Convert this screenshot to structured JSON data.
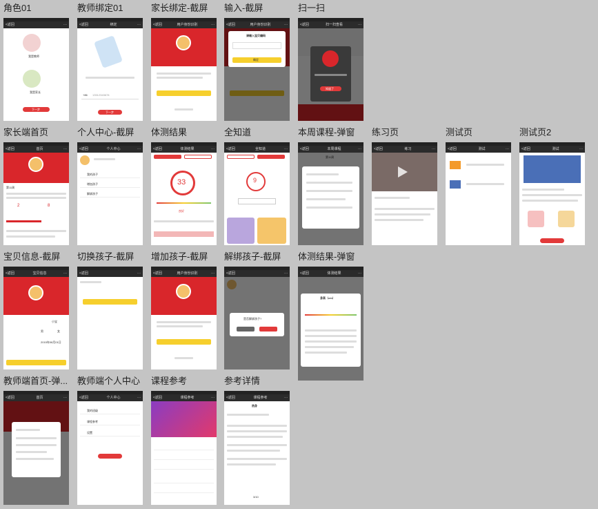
{
  "screens": [
    {
      "title": "角色01"
    },
    {
      "title": "教师绑定01"
    },
    {
      "title": "家长绑定-截屏"
    },
    {
      "title": "输入-截屏"
    },
    {
      "title": "扫一扫"
    },
    {
      "title": "家长端首页"
    },
    {
      "title": "个人中心-截屏"
    },
    {
      "title": "体测结果"
    },
    {
      "title": "全知道"
    },
    {
      "title": "本周课程-弹窗"
    },
    {
      "title": "练习页"
    },
    {
      "title": "测试页"
    },
    {
      "title": "测试页2"
    },
    {
      "title": "宝贝信息-截屏"
    },
    {
      "title": "切换孩子-截屏"
    },
    {
      "title": "增加孩子-截屏"
    },
    {
      "title": "解绑孩子-截屏"
    },
    {
      "title": "体测结果-弹窗"
    },
    {
      "title": "教师端首页-弹..."
    },
    {
      "title": "教师端个人中心"
    },
    {
      "title": "课程参考"
    },
    {
      "title": "参考详情"
    }
  ],
  "nav": {
    "back": "<返回",
    "close": "关闭",
    "more": "···",
    "t_bind": "绑定",
    "t_identity": "用户身份识别",
    "t_scan": "扫一扫查看",
    "t_home": "首页",
    "t_center": "个人中心",
    "t_test": "体测结果",
    "t_know": "全知道",
    "t_course": "本周课程",
    "t_practice": "练习",
    "t_exam": "测试",
    "t_ref": "课程参考",
    "t_refd": "课程参考",
    "t_baby": "宝贝信息"
  },
  "texts": {
    "next": "下一步",
    "bind_teacher": "我是教师",
    "bind_parent": "我是家长",
    "phone_prefix": "+86",
    "phone_num": "13512345678",
    "input_baby": "请输入宝贝编码",
    "confirm": "确定",
    "scan_known": "知道了",
    "scan_tip": "请用微信扫码",
    "score": "33",
    "score2": "9",
    "good": "良好",
    "week": "第11周",
    "height": "身高（cm）",
    "unbind_q": "是否解绑孩子?",
    "cancel": "取消",
    "ok": "确定",
    "add": "添加",
    "save": "保存",
    "child_name": "小宝",
    "date": "2015年08月01日",
    "boy": "男",
    "girl": "女",
    "mine": "我的",
    "class": "班级",
    "page": "3/10",
    "ref_title": "热身",
    "center_a": "我的孩子",
    "center_b": "增加孩子",
    "center_c": "解绑孩子",
    "t_menu1": "我的班级",
    "t_menu2": "课程参考",
    "t_menu3": "设置",
    "logout": "退出登录"
  },
  "colors": {
    "red": "#d9262b",
    "yellow": "#f6cf2d",
    "dark": "#2b2b2b"
  }
}
